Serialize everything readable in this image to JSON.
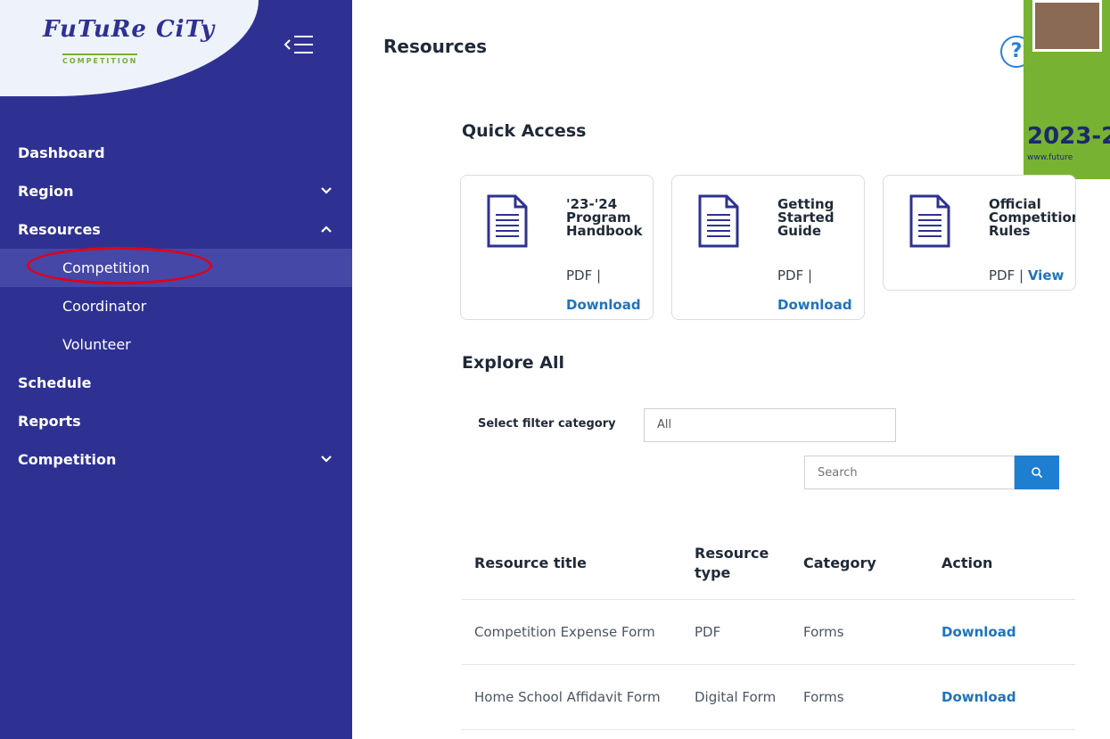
{
  "sidebar": {
    "logo": {
      "text": "FuTuRe CiTy",
      "sub": "COMPETITION"
    },
    "items": [
      {
        "label": "Dashboard"
      },
      {
        "label": "Region"
      },
      {
        "label": "Resources"
      },
      {
        "label": "Competition"
      },
      {
        "label": "Coordinator"
      },
      {
        "label": "Volunteer"
      },
      {
        "label": "Schedule"
      },
      {
        "label": "Reports"
      },
      {
        "label": "Competition"
      }
    ]
  },
  "header": {
    "title": "Resources",
    "help": "?"
  },
  "promo": {
    "year": "2023-2",
    "url": "www.future"
  },
  "quick_access": {
    "title": "Quick Access",
    "cards": [
      {
        "title": "'23-'24 Program Handbook",
        "type": "PDF |",
        "link": "Download"
      },
      {
        "title": "Getting Started Guide",
        "type": "PDF |",
        "link": "Download"
      },
      {
        "title": "Official Competition Rules",
        "type": "PDF |",
        "link": "View"
      }
    ]
  },
  "explore": {
    "title": "Explore All",
    "filter_label": "Select filter category",
    "filter_value": "All",
    "search_placeholder": "Search"
  },
  "table": {
    "headers": [
      "Resource title",
      "Resource type",
      "Category",
      "Action"
    ],
    "rows": [
      {
        "title": "Competition Expense Form",
        "type": "PDF",
        "category": "Forms",
        "action": "Download"
      },
      {
        "title": "Home School Affidavit Form",
        "type": "Digital Form",
        "category": "Forms",
        "action": "Download"
      }
    ]
  },
  "colors": {
    "sidebar": "#2e3192",
    "accent": "#1e73be",
    "highlight": "#e1001b",
    "promo": "#77b233"
  }
}
